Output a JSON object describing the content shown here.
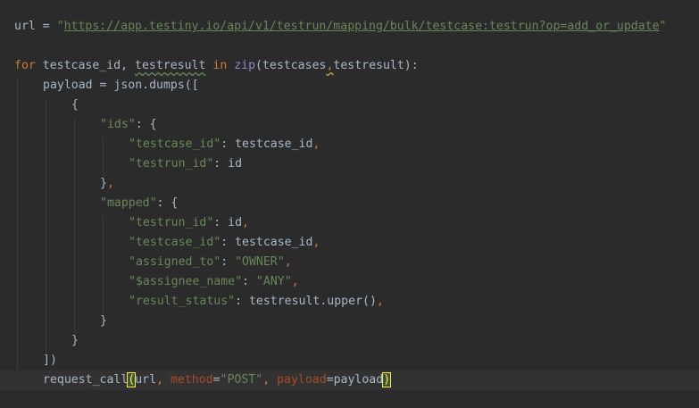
{
  "editor": {
    "lines": {
      "l1": {
        "var": "url",
        "eq": " = ",
        "q1": "\"",
        "url": "https://app.testiny.io/api/v1/testrun/mapping/bulk/testcase:testrun?op=add_or_update",
        "q2": "\""
      },
      "l2": {
        "for": "for",
        "sp1": " ",
        "v1": "testcase_id",
        "comma": ", ",
        "v2": "testresult",
        "sp2": " ",
        "in": "in",
        "sp3": " ",
        "zip": "zip",
        "open": "(testcases",
        "c2": ",",
        "rest": "testresult):"
      },
      "l3": "payload = json.dumps([",
      "l4": "{",
      "l5": {
        "key": "\"ids\"",
        "rest": ": {"
      },
      "l6": {
        "key": "\"testcase_id\"",
        "rest": ": testcase_id",
        "comma": ","
      },
      "l7": {
        "key": "\"testrun_id\"",
        "rest": ": id"
      },
      "l8": {
        "text": "}",
        "comma": ","
      },
      "l9": {
        "key": "\"mapped\"",
        "rest": ": {"
      },
      "l10": {
        "key": "\"testrun_id\"",
        "rest": ": id",
        "comma": ","
      },
      "l11": {
        "key": "\"testcase_id\"",
        "rest": ": testcase_id",
        "comma": ","
      },
      "l12": {
        "key": "\"assigned_to\"",
        "rest": ": ",
        "val": "\"OWNER\"",
        "comma": ","
      },
      "l13": {
        "key": "\"$assignee_name\"",
        "rest": ": ",
        "val": "\"ANY\"",
        "comma": ","
      },
      "l14": {
        "key": "\"result_status\"",
        "rest": ": testresult.upper()",
        "comma": ","
      },
      "l15": "}",
      "l16": "}",
      "l17": "])",
      "l18": {
        "fn": "request_call",
        "open": "(",
        "a1": "url",
        "c1": ", ",
        "p1": "method",
        "eq1": "=",
        "s1": "\"POST\"",
        "c2": ", ",
        "p2": "payload",
        "eq2": "=payload",
        "close": ")"
      }
    }
  },
  "colors": {
    "background": "#2b2b2b",
    "current_line": "#323232",
    "keyword": "#cc7832",
    "string": "#6a8759",
    "default_text": "#a9b7c6",
    "builtin": "#8888c6",
    "named_param": "#aa4926",
    "bracket_match": "#ffef28"
  }
}
